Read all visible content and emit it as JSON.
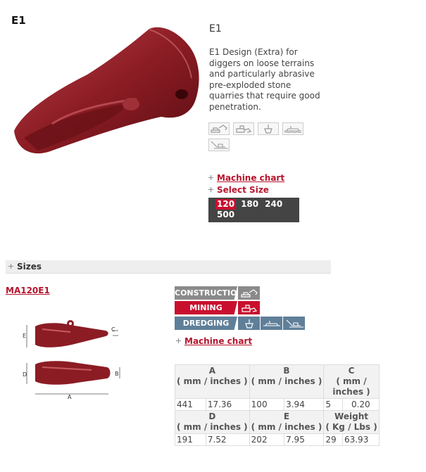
{
  "product": {
    "code": "E1",
    "title": "E1",
    "description": "E1 Design (Extra) for diggers on loose terrains and particularly abrasive pre-exploded stone quarries that require good penetration."
  },
  "application_icons": [
    "excavator-icon",
    "loader-icon",
    "bucket-icon",
    "dredger-icon",
    "mining-excavator-icon"
  ],
  "links": {
    "machine_chart": "Machine chart",
    "select_size": "Select Size"
  },
  "sizes": [
    "120",
    "180",
    "240",
    "500"
  ],
  "selected_size": "120",
  "sizes_section": "Sizes",
  "model": {
    "code": "MA120E1",
    "categories": [
      {
        "label": "CONSTRUCTION",
        "color": "#8a8a8a"
      },
      {
        "label": "MINING",
        "color": "#c8102e"
      },
      {
        "label": "DREDGING",
        "color": "#5f7f99"
      }
    ],
    "machine_chart": "Machine chart",
    "diagram_labels": {
      "a": "A",
      "b": "B",
      "c": "C",
      "d": "D",
      "e": "E"
    },
    "specs": {
      "row1_headers": [
        {
          "letter": "A",
          "unit": "( mm / inches )"
        },
        {
          "letter": "B",
          "unit": "( mm / inches )"
        },
        {
          "letter": "C",
          "unit": "( mm / inches )"
        }
      ],
      "row1_values": [
        "441",
        "17.36",
        "100",
        "3.94",
        "5",
        "0.20"
      ],
      "row2_headers": [
        {
          "letter": "D",
          "unit": "( mm / inches )"
        },
        {
          "letter": "E",
          "unit": "( mm / inches )"
        },
        {
          "letter": "Weight",
          "unit": "( Kg / Lbs )"
        }
      ],
      "row2_values": [
        "191",
        "7.52",
        "202",
        "7.95",
        "29",
        "63.93"
      ]
    }
  },
  "colors": {
    "accent": "#b5152d",
    "tooth": "#8c1c24",
    "size_box": "#444444"
  }
}
